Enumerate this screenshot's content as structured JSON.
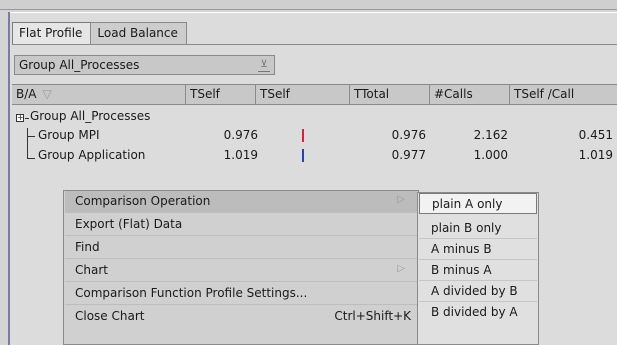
{
  "tabs": [
    "Flat Profile",
    "Load Balance"
  ],
  "group_combo": {
    "value": "Group All_Processes",
    "arrow": "⊻"
  },
  "columns": [
    "B/A",
    "TSelf",
    "TSelf",
    "TTotal",
    "#Calls",
    "TSelf /Call"
  ],
  "sort_glyph": "▽",
  "tree": {
    "root_label": "Group All_Processes",
    "expander": "+",
    "rows": [
      {
        "label": "Group MPI",
        "tself": "0.976",
        "ttotal": "0.976",
        "calls": "2.162",
        "tself_per_call": "0.451",
        "bar_color": "#e0202a"
      },
      {
        "label": "Group Application",
        "tself": "1.019",
        "ttotal": "0.977",
        "calls": "1.000",
        "tself_per_call": "1.019",
        "bar_color": "#2040c8"
      }
    ]
  },
  "context_menu": {
    "items": [
      {
        "label": "Comparison Operation",
        "submenu": true
      },
      {
        "label": "Export (Flat) Data",
        "submenu": false
      },
      {
        "label": "Find",
        "submenu": false
      },
      {
        "label": "Chart",
        "submenu": true
      },
      {
        "label": "Comparison Function Profile Settings...",
        "submenu": false
      },
      {
        "label": "Close Chart",
        "shortcut": "Ctrl+Shift+K"
      }
    ],
    "submenu_mark": "▷"
  },
  "comparison_submenu": {
    "items": [
      "plain A only",
      "plain B only",
      "A minus B",
      "B minus A",
      "A divided by B",
      "B divided by A"
    ],
    "selected_index": 0
  }
}
